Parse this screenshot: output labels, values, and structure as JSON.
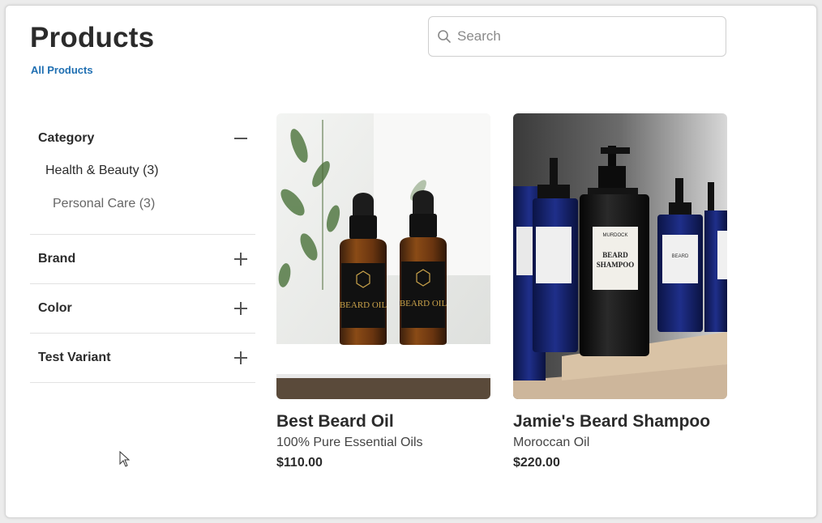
{
  "page": {
    "title": "Products",
    "breadcrumb": "All Products"
  },
  "search": {
    "placeholder": "Search",
    "value": ""
  },
  "filters": {
    "category": {
      "label": "Category",
      "expanded": true,
      "items": [
        {
          "label": "Health & Beauty (3)"
        },
        {
          "label": "Personal Care (3)"
        }
      ]
    },
    "brand": {
      "label": "Brand",
      "expanded": false
    },
    "color": {
      "label": "Color",
      "expanded": false
    },
    "test_variant": {
      "label": "Test Variant",
      "expanded": false
    }
  },
  "products": [
    {
      "name": "Best Beard Oil",
      "description": "100% Pure Essential Oils",
      "price": "$110.00",
      "image_label": "BEARD OIL"
    },
    {
      "name": "Jamie's Beard Shampoo",
      "description": "Moroccan Oil",
      "price": "$220.00",
      "image_label": "BEARD SHAMPOO",
      "image_brand": "MURDOCK"
    }
  ],
  "colors": {
    "accent": "#1f6fb2",
    "text": "#2b2b2b"
  }
}
